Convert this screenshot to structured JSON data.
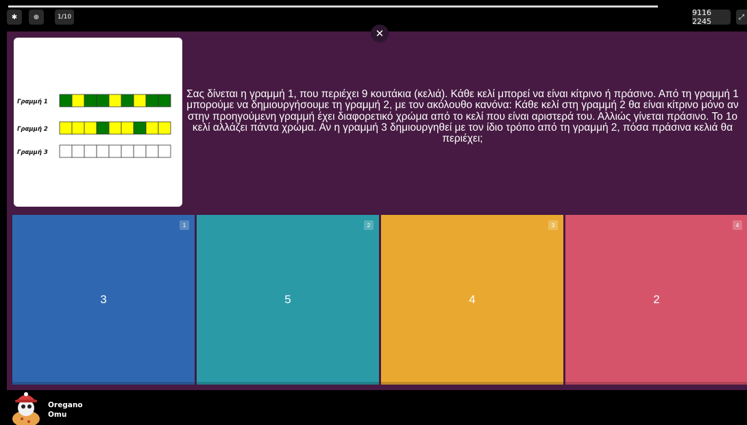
{
  "toolbar": {
    "settings_icon": "gear-icon",
    "zoom_icon": "zoom-in-icon",
    "question_counter": "1/10",
    "game_code": "9116 2245",
    "fullscreen_icon": "fullscreen-icon",
    "progress_fraction": 0.87
  },
  "question": {
    "close_icon": "close-icon",
    "text": "Σας δίνεται η γραμμή 1, που περιέχει 9 κουτάκια (κελιά). Κάθε κελί μπορεί να είναι κίτρινο ή πράσινο. Από τη γραμμή 1 μπορούμε να δημιουργήσουμε τη γραμμή 2, με τον ακόλουθο κανόνα: Κάθε κελί στη γραμμή 2 θα είναι κίτρινο μόνο αν στην προηγούμενη γραμμή έχει διαφορετικό χρώμα από το κελί που είναι αριστερά του. Αλλιώς γίνεται πράσινο. Το 1ο κελί αλλάζει πάντα χρώμα. Αν η γραμμή 3 δημιουργηθεί με τον ίδιο τρόπο από τη γραμμή 2, πόσα πράσινα κελιά θα περιέχει;",
    "figure": {
      "row_labels": [
        "Γραμμή 1",
        "Γραμμή 2",
        "Γραμμή 3"
      ],
      "rows": [
        [
          "G",
          "Y",
          "G",
          "G",
          "Y",
          "G",
          "Y",
          "G",
          "G"
        ],
        [
          "Y",
          "Y",
          "Y",
          "G",
          "Y",
          "Y",
          "G",
          "Y",
          "Y"
        ],
        [
          "W",
          "W",
          "W",
          "W",
          "W",
          "W",
          "W",
          "W",
          "W"
        ]
      ],
      "colors": {
        "G": "#007a00",
        "Y": "#ffff00",
        "W": "#ffffff"
      }
    }
  },
  "options": [
    {
      "number": "1",
      "value": "3",
      "color": "#2f68b0"
    },
    {
      "number": "2",
      "value": "5",
      "color": "#2a9aa7"
    },
    {
      "number": "3",
      "value": "4",
      "color": "#e9a930"
    },
    {
      "number": "4",
      "value": "2",
      "color": "#d6546a"
    }
  ],
  "player": {
    "first_name": "Oregano",
    "last_name": "Omu"
  }
}
